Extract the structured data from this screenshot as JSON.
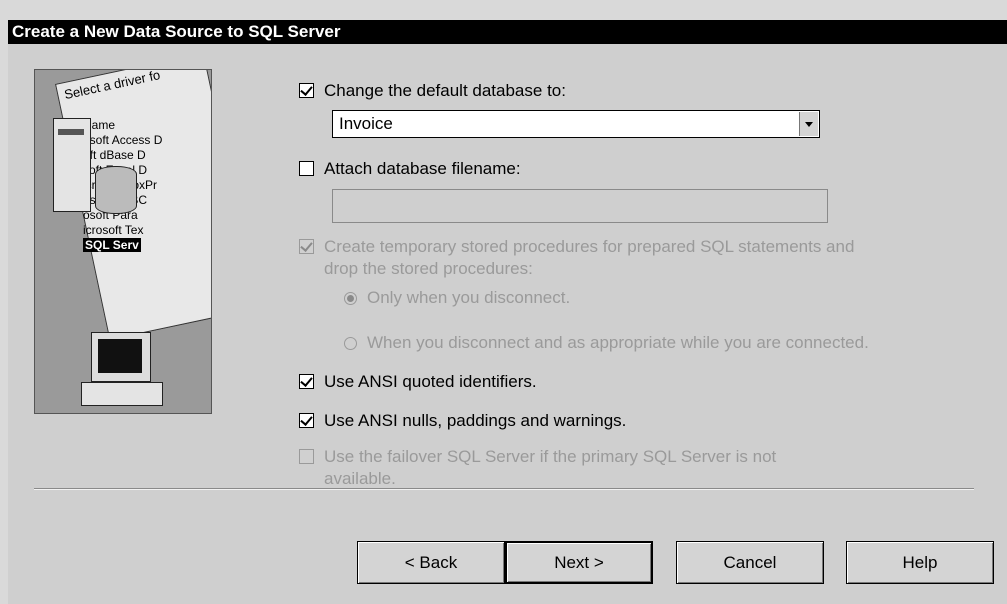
{
  "window": {
    "title": "Create a New Data Source to SQL Server"
  },
  "illustration": {
    "caption": "Select a driver fo",
    "drivers": [
      "Name",
      "osoft Access D",
      "oft dBase D",
      "soft Excel D",
      "icrosoft FoxPr",
      "osoft ODBC",
      "osoft Para",
      "icrosoft Tex"
    ],
    "selected_driver": "SQL Serv"
  },
  "options": {
    "change_default_db": {
      "label": "Change the default database to:",
      "checked": true
    },
    "database_combo": {
      "value": "Invoice"
    },
    "attach_db": {
      "label": "Attach database filename:",
      "checked": false
    },
    "create_temp_procs": {
      "label_line1": "Create temporary stored procedures for prepared SQL statements and",
      "label_line2": "drop the stored procedures:",
      "checked": true,
      "enabled": false
    },
    "radio_disconnect": {
      "label": "Only when you disconnect.",
      "selected": true
    },
    "radio_appropriate": {
      "label": "When you disconnect and as appropriate while you are connected.",
      "selected": false
    },
    "ansi_quoted": {
      "label": "Use ANSI quoted identifiers.",
      "checked": true
    },
    "ansi_nulls": {
      "label": "Use ANSI nulls, paddings and warnings.",
      "checked": true
    },
    "failover": {
      "label_line1": "Use the failover SQL Server if the primary SQL Server is not",
      "label_line2": "available.",
      "checked": false,
      "enabled": false
    }
  },
  "buttons": {
    "back": "< Back",
    "next": "Next >",
    "cancel": "Cancel",
    "help": "Help"
  }
}
